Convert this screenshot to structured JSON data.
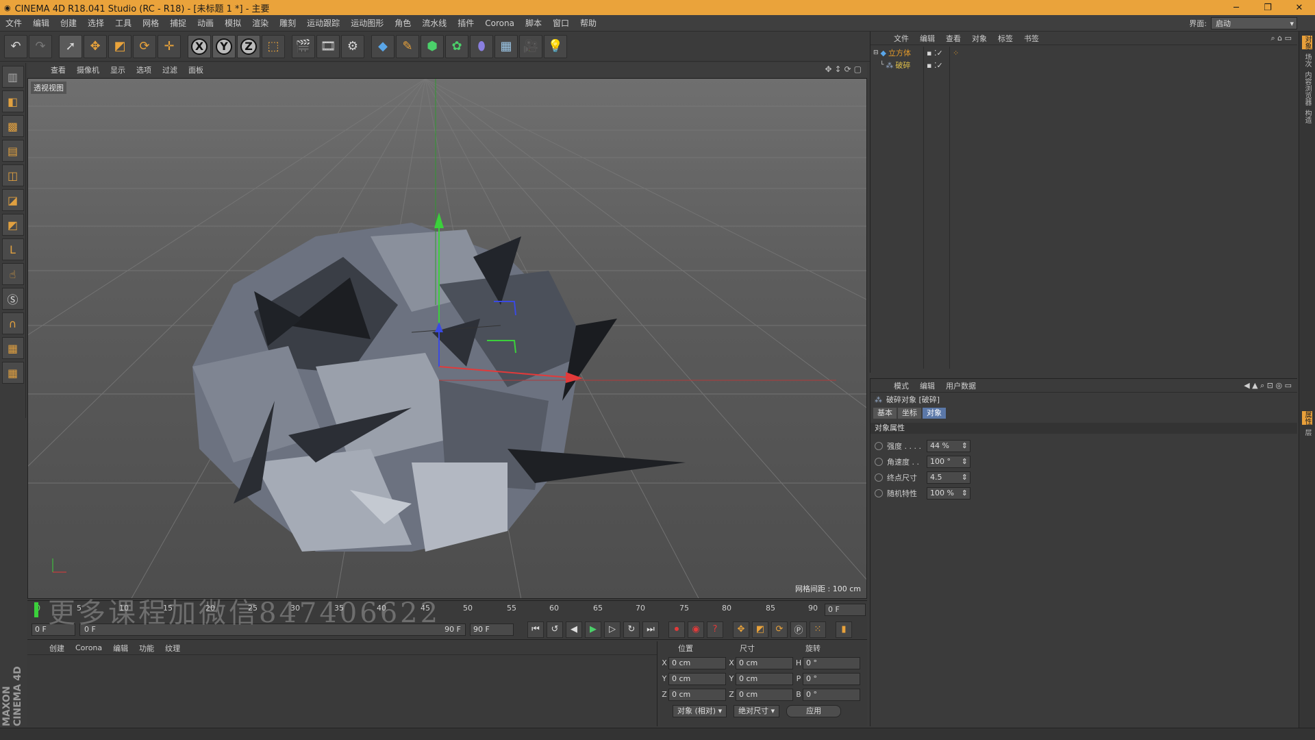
{
  "window": {
    "title": "CINEMA 4D R18.041 Studio (RC - R18) - [未标题 1 *] - 主要",
    "controls": [
      "─",
      "❐",
      "✕"
    ]
  },
  "menubar": {
    "items": [
      "文件",
      "编辑",
      "创建",
      "选择",
      "工具",
      "网格",
      "捕捉",
      "动画",
      "模拟",
      "渲染",
      "雕刻",
      "运动跟踪",
      "运动图形",
      "角色",
      "流水线",
      "插件",
      "Corona",
      "脚本",
      "窗口",
      "帮助"
    ],
    "layout_label": "界面:",
    "layout_value": "启动"
  },
  "viewport": {
    "menu": [
      "查看",
      "摄像机",
      "显示",
      "选项",
      "过滤",
      "面板"
    ],
    "view_name": "透视视图",
    "grid_spacing": "网格间距 : 100 cm",
    "nav_icons": "✥↕⟳▢"
  },
  "timeline": {
    "ticks": [
      "0",
      "5",
      "10",
      "15",
      "20",
      "25",
      "30",
      "35",
      "40",
      "45",
      "50",
      "55",
      "60",
      "65",
      "70",
      "75",
      "80",
      "85",
      "90"
    ],
    "current_frame": "0 F",
    "start_frame": "0 F",
    "range_start": "0 F",
    "range_end": "90 F",
    "end_frame": "90 F"
  },
  "material_manager": {
    "menu": [
      "创建",
      "Corona",
      "编辑",
      "功能",
      "纹理"
    ]
  },
  "coordinates": {
    "headers": [
      "位置",
      "尺寸",
      "旋转"
    ],
    "rows": [
      {
        "axis": "X",
        "pos": "0 cm",
        "size_axis": "X",
        "size": "0 cm",
        "rot_axis": "H",
        "rot": "0 °"
      },
      {
        "axis": "Y",
        "pos": "0 cm",
        "size_axis": "Y",
        "size": "0 cm",
        "rot_axis": "P",
        "rot": "0 °"
      },
      {
        "axis": "Z",
        "pos": "0 cm",
        "size_axis": "Z",
        "size": "0 cm",
        "rot_axis": "B",
        "rot": "0 °"
      }
    ],
    "mode": "对象 (相对)",
    "size_mode": "绝对尺寸",
    "apply": "应用"
  },
  "object_manager": {
    "menu": [
      "文件",
      "编辑",
      "查看",
      "对象",
      "标签",
      "书签"
    ],
    "objects": [
      {
        "name": "立方体",
        "color": "#e39a2a"
      },
      {
        "name": "破碎",
        "color": "#e0c04a"
      }
    ]
  },
  "attribute_manager": {
    "menu": [
      "模式",
      "编辑",
      "用户数据"
    ],
    "object_title": "破碎对象 [破碎]",
    "tabs": [
      "基本",
      "坐标",
      "对象"
    ],
    "active_tab": 2,
    "section": "对象属性",
    "props": [
      {
        "label": "强度 . . . .",
        "value": "44 %"
      },
      {
        "label": "角速度 . .",
        "value": "100 °"
      },
      {
        "label": "终点尺寸",
        "value": "4.5"
      },
      {
        "label": "随机特性",
        "value": "100 %"
      }
    ]
  },
  "right_strip": [
    "对象",
    "场次",
    "内容浏览器",
    "构造",
    "属性",
    "层"
  ],
  "watermark": "更多课程加微信847406622",
  "maxon": "MAXON CINEMA 4D",
  "colors": {
    "title_bar": "#eaa33b",
    "accent": "#5b78a8"
  }
}
